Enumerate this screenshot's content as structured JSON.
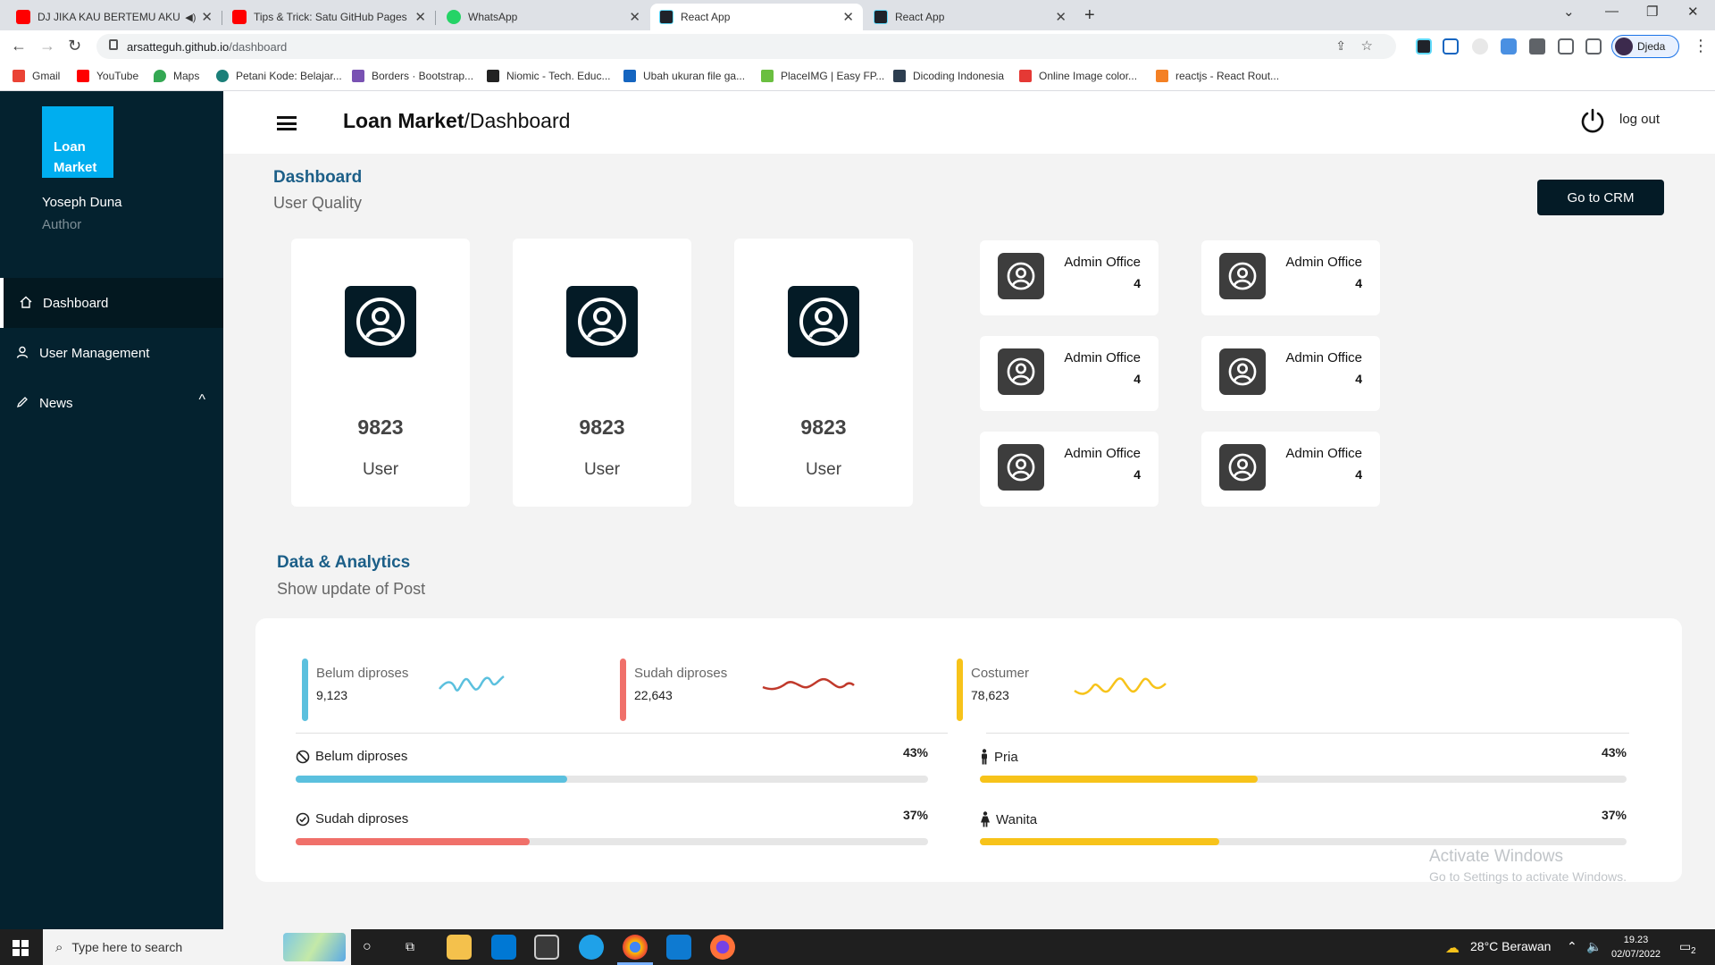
{
  "browser": {
    "tabs": [
      {
        "title": "DJ JIKA KAU BERTEMU AKU",
        "icon": "youtube-icon",
        "color": "#ff0000"
      },
      {
        "title": "Tips & Trick: Satu GitHub Pages u",
        "icon": "youtube-icon",
        "color": "#ff0000"
      },
      {
        "title": "WhatsApp",
        "icon": "whatsapp-icon",
        "color": "#25d366"
      },
      {
        "title": "React App",
        "icon": "react-icon",
        "color": "#20232a"
      },
      {
        "title": "React App",
        "icon": "react-icon",
        "color": "#20232a"
      }
    ],
    "url_host": "arsatteguh.github.io",
    "url_path": "/dashboard",
    "profile": "Djeda",
    "bookmarks": [
      {
        "label": "Gmail",
        "color": "#ea4335"
      },
      {
        "label": "YouTube",
        "color": "#ff0000"
      },
      {
        "label": "Maps",
        "color": "#34a853"
      },
      {
        "label": "Petani Kode: Belajar...",
        "color": "#1b7f79"
      },
      {
        "label": "Borders · Bootstrap...",
        "color": "#7952b3"
      },
      {
        "label": "Niomic - Tech. Educ...",
        "color": "#222222"
      },
      {
        "label": "Ubah ukuran file ga...",
        "color": "#1565c0"
      },
      {
        "label": "PlaceIMG | Easy FP...",
        "color": "#6abf40"
      },
      {
        "label": "Dicoding Indonesia",
        "color": "#2d3e50"
      },
      {
        "label": "Online Image color...",
        "color": "#e53935"
      },
      {
        "label": "reactjs - React Rout...",
        "color": "#f48024"
      }
    ]
  },
  "sidebar": {
    "brand_line1": "Loan",
    "brand_line2": "Market",
    "user_name": "Yoseph Duna",
    "user_role": "Author",
    "items": [
      {
        "label": "Dashboard",
        "icon": "home-icon"
      },
      {
        "label": "User Management",
        "icon": "user-icon"
      },
      {
        "label": "News",
        "icon": "pencil-icon",
        "caret": "^"
      }
    ]
  },
  "header": {
    "title_bold": "Loan Market",
    "title_rest": "/Dashboard",
    "logout": "log out"
  },
  "dashboard": {
    "title": "Dashboard",
    "subtitle": "User Quality",
    "crm_button": "Go to CRM",
    "user_cards": [
      {
        "value": "9823",
        "label": "User"
      },
      {
        "value": "9823",
        "label": "User"
      },
      {
        "value": "9823",
        "label": "User"
      }
    ],
    "admin_cards": [
      {
        "title": "Admin Office",
        "value": "4"
      },
      {
        "title": "Admin Office",
        "value": "4"
      },
      {
        "title": "Admin Office",
        "value": "4"
      },
      {
        "title": "Admin Office",
        "value": "4"
      },
      {
        "title": "Admin Office",
        "value": "4"
      },
      {
        "title": "Admin Office",
        "value": "4"
      }
    ]
  },
  "analytics": {
    "title": "Data & Analytics",
    "subtitle": "Show update of Post",
    "stats": [
      {
        "label": "Belum diproses",
        "value": "9,123",
        "color": "#5bc0de"
      },
      {
        "label": "Sudah diproses",
        "value": "22,643",
        "color": "#f0706a"
      },
      {
        "label": "Costumer",
        "value": "78,623",
        "color": "#f7c31a"
      }
    ],
    "progress": [
      {
        "label": "Belum diproses",
        "percent": "43%",
        "fraction": 0.43,
        "color": "#5bc0de",
        "icon": "ban-icon"
      },
      {
        "label": "Sudah diproses",
        "percent": "37%",
        "fraction": 0.37,
        "color": "#f0706a",
        "icon": "check-circle-icon"
      },
      {
        "label": "Pria",
        "percent": "43%",
        "fraction": 0.43,
        "color": "#f7c31a",
        "icon": "male-icon"
      },
      {
        "label": "Wanita",
        "percent": "37%",
        "fraction": 0.37,
        "color": "#f7c31a",
        "icon": "female-icon"
      }
    ]
  },
  "watermark": {
    "line1": "Activate Windows",
    "line2": "Go to Settings to activate Windows."
  },
  "taskbar": {
    "search_placeholder": "Type here to search",
    "weather": "28°C  Berawan",
    "time": "19.23",
    "date": "02/07/2022",
    "notification_count": "2"
  }
}
